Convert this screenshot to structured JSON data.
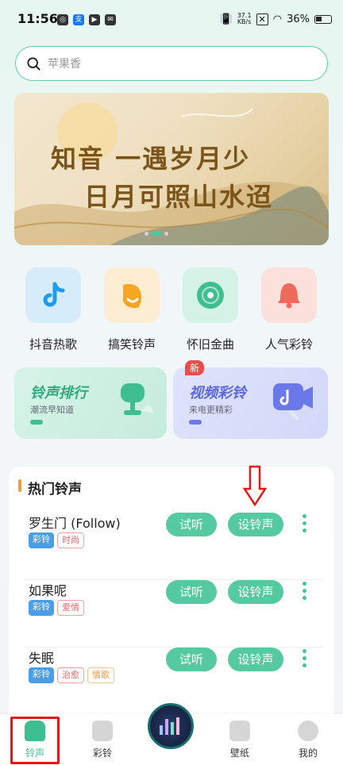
{
  "status_bar": {
    "time": "11:56",
    "net_speed_value": "37.1",
    "net_speed_unit": "KB/s",
    "battery": "36%"
  },
  "search": {
    "placeholder": "苹果香"
  },
  "banner": {
    "line1": "知音 一遇岁月少",
    "line2": "日月可照山水迢",
    "dots_total": 3,
    "active_dot": 1
  },
  "categories": [
    {
      "label": "抖音热歌",
      "icon": "tiktok-note-icon",
      "color": "#1e9bf0"
    },
    {
      "label": "搞笑铃声",
      "icon": "funny-face-icon",
      "color": "#f5a623"
    },
    {
      "label": "怀旧金曲",
      "icon": "vinyl-record-icon",
      "color": "#3fbe92"
    },
    {
      "label": "人气彩铃",
      "icon": "bell-icon",
      "color": "#ef6a5a"
    }
  ],
  "features": [
    {
      "title": "铃声排行",
      "subtitle": "潮流早知道",
      "icon": "trophy-icon",
      "accent": "#3fbe92"
    },
    {
      "title": "视频彩铃",
      "subtitle": "来电更精彩",
      "icon": "video-note-icon",
      "accent": "#6a78e8",
      "badge": "新"
    }
  ],
  "hot_list": {
    "title": "热门铃声",
    "listen_label": "试听",
    "set_label": "设铃声",
    "items": [
      {
        "name": "罗生门 (Follow)",
        "tags": [
          {
            "text": "彩铃",
            "style": "blue"
          },
          {
            "text": "时尚",
            "style": "red"
          }
        ]
      },
      {
        "name": "如果呢",
        "tags": [
          {
            "text": "彩铃",
            "style": "blue"
          },
          {
            "text": "爱情",
            "style": "red"
          }
        ]
      },
      {
        "name": "失眠",
        "tags": [
          {
            "text": "彩铃",
            "style": "blue"
          },
          {
            "text": "治愈",
            "style": "red"
          },
          {
            "text": "情歌",
            "style": "orange"
          }
        ]
      }
    ]
  },
  "bottom_nav": {
    "items": [
      {
        "label": "铃声",
        "icon": "ringtone-icon",
        "active": true
      },
      {
        "label": "彩铃",
        "icon": "color-ring-icon",
        "active": false
      },
      {
        "label": "",
        "icon": "music-visualizer-icon",
        "active": false
      },
      {
        "label": "壁纸",
        "icon": "wallpaper-icon",
        "active": false
      },
      {
        "label": "我的",
        "icon": "profile-icon",
        "active": false
      }
    ]
  },
  "colors": {
    "accent": "#3fbe92",
    "annotation": "#e01818"
  }
}
